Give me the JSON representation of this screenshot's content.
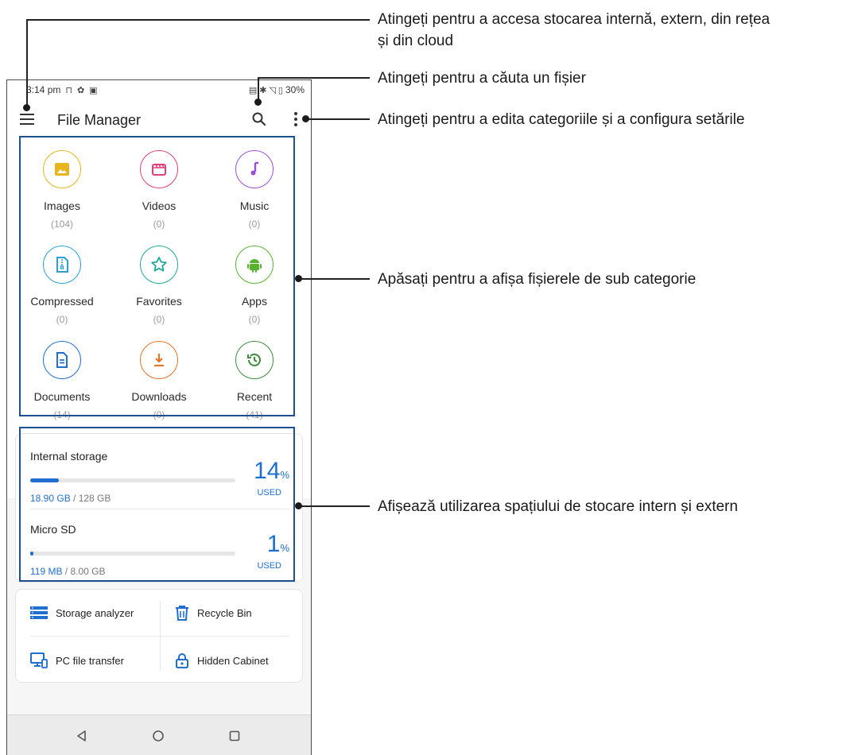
{
  "status_bar": {
    "time": "3:14 pm",
    "battery": "30%"
  },
  "app_bar": {
    "title": "File Manager"
  },
  "categories": [
    {
      "name": "Images",
      "count": "(104)",
      "color": "#e8b51c",
      "icon": "image-icon"
    },
    {
      "name": "Videos",
      "count": "(0)",
      "color": "#e0407a",
      "icon": "video-icon"
    },
    {
      "name": "Music",
      "count": "(0)",
      "color": "#9b4fd6",
      "icon": "music-icon"
    },
    {
      "name": "Compressed",
      "count": "(0)",
      "color": "#2aa0d8",
      "icon": "zip-icon"
    },
    {
      "name": "Favorites",
      "count": "(0)",
      "color": "#20a89a",
      "icon": "star-icon"
    },
    {
      "name": "Apps",
      "count": "(0)",
      "color": "#57b32e",
      "icon": "android-icon"
    },
    {
      "name": "Documents",
      "count": "(14)",
      "color": "#1f6fd0",
      "icon": "document-icon"
    },
    {
      "name": "Downloads",
      "count": "(0)",
      "color": "#e0762a",
      "icon": "download-icon"
    },
    {
      "name": "Recent",
      "count": "(41)",
      "color": "#3c8a3c",
      "icon": "history-icon"
    }
  ],
  "storage": [
    {
      "name": "Internal storage",
      "used": "18.90 GB",
      "total": " / 128 GB",
      "percent": "14",
      "percent_unit": "%",
      "used_label": "USED",
      "fraction": 0.14
    },
    {
      "name": "Micro SD",
      "used": "119 MB",
      "total": " / 8.00 GB",
      "percent": "1",
      "percent_unit": "%",
      "used_label": "USED",
      "fraction": 0.01
    }
  ],
  "tools": {
    "storage_analyzer": "Storage analyzer",
    "recycle_bin": "Recycle Bin",
    "pc_file_transfer": "PC file transfer",
    "hidden_cabinet": "Hidden Cabinet"
  },
  "callouts": {
    "storage_locations": "Atingeți pentru a accesa stocarea internă, extern, din rețea",
    "storage_locations_2": "și din cloud",
    "search": "Atingeți pentru a căuta un fișier",
    "settings": "Atingeți pentru a edita categoriile și a configura setările",
    "subcategory": "Apăsați pentru a afișa fișierele de sub categorie",
    "usage": "Afișează utilizarea spațiului de stocare intern și extern"
  },
  "colors": {
    "accent": "#1f6fd0",
    "highlight_box": "#1d4f91"
  }
}
